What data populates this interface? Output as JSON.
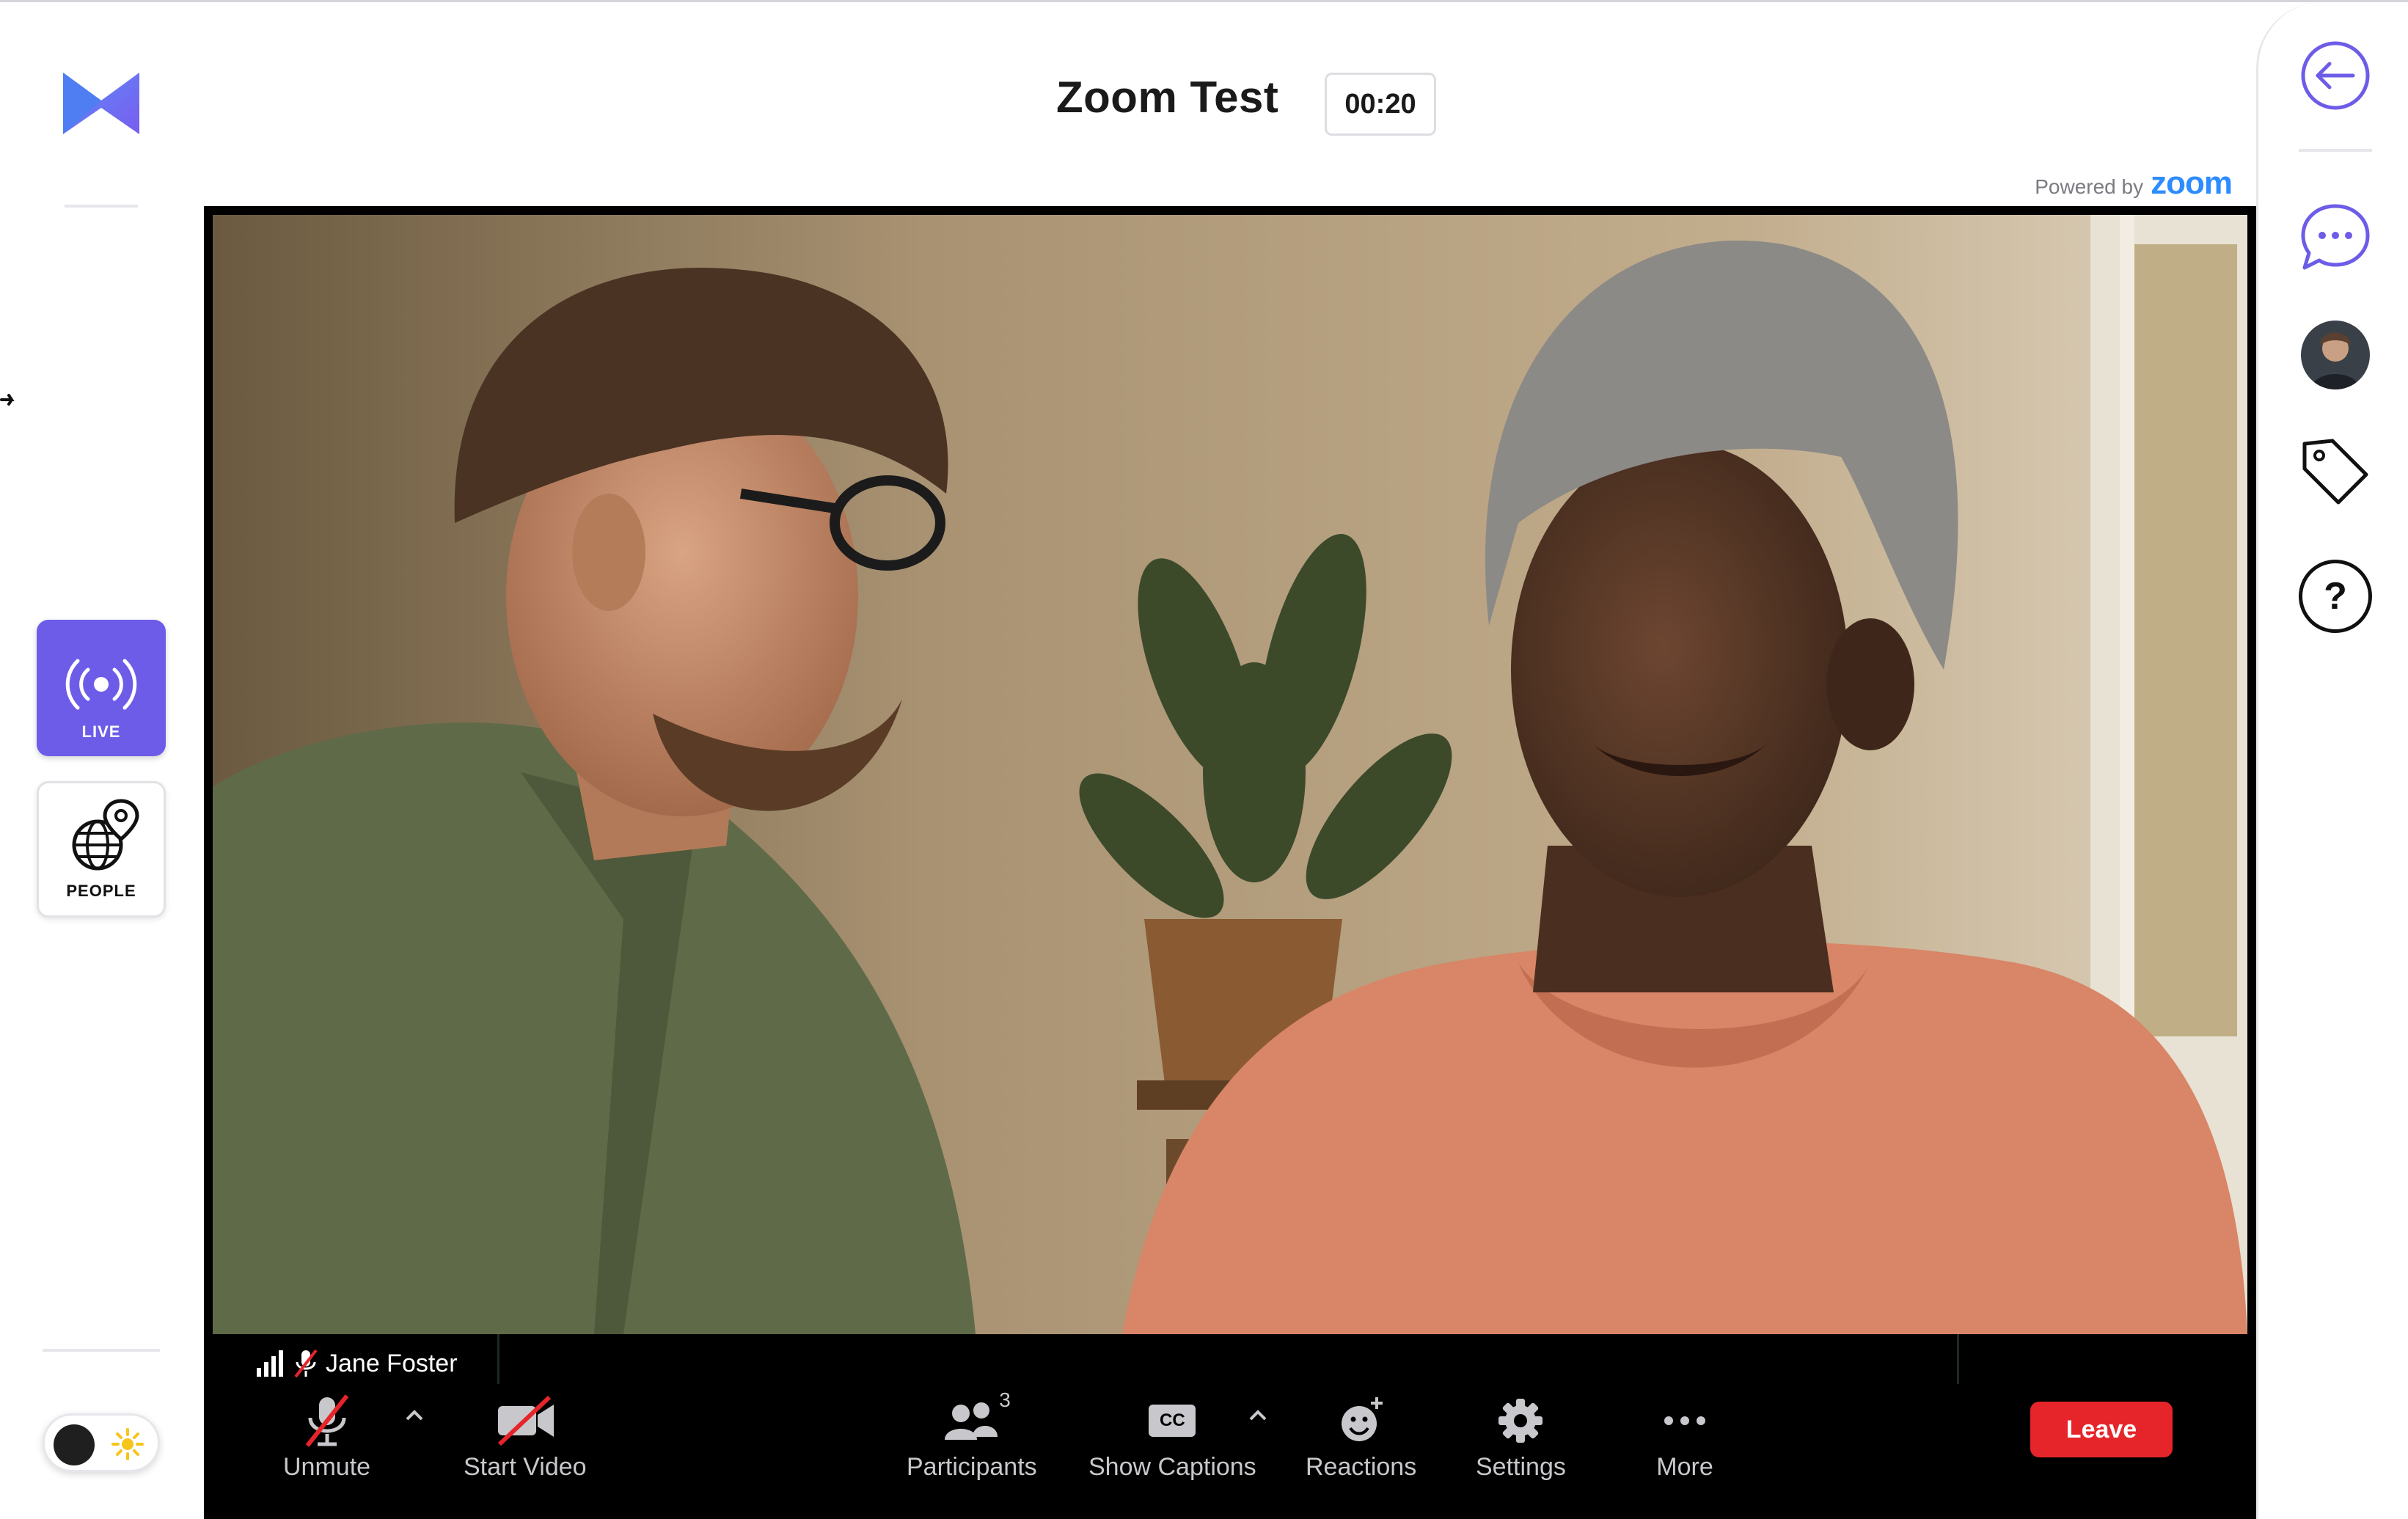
{
  "header": {
    "title": "Zoom Test",
    "timer": "00:20",
    "powered_by_text": "Powered by",
    "powered_by_brand": "zoom"
  },
  "left_sidebar": {
    "logo_icon": "bowtie-logo-icon",
    "items": [
      {
        "label": "LIVE",
        "icon": "broadcast-icon",
        "active": true
      },
      {
        "label": "PEOPLE",
        "icon": "globe-pin-icon",
        "active": false
      }
    ],
    "theme_toggle": {
      "mode": "dark",
      "icons": [
        "dark-circle-icon",
        "sun-icon"
      ]
    }
  },
  "video": {
    "participant_name": "Jane Foster",
    "participant_status_icons": [
      "signal-bars-icon",
      "mic-muted-icon"
    ]
  },
  "toolbar": {
    "unmute_label": "Unmute",
    "start_video_label": "Start Video",
    "participants_label": "Participants",
    "participants_count": "3",
    "show_captions_label": "Show Captions",
    "cc_glyph": "CC",
    "reactions_label": "Reactions",
    "settings_label": "Settings",
    "more_label": "More",
    "leave_label": "Leave"
  },
  "right_rail": {
    "items": [
      "back-arrow-icon",
      "chat-bubble-icon",
      "user-avatar",
      "tag-icon",
      "help-icon"
    ],
    "help_glyph": "?"
  },
  "colors": {
    "accent_purple": "#6d5ce8",
    "zoom_blue": "#2d8cff",
    "leave_red": "#e5252a",
    "toolbar_bg": "#000000"
  }
}
